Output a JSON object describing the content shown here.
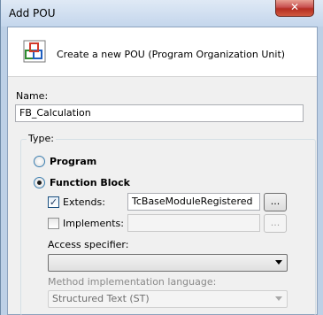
{
  "window": {
    "title": "Add POU",
    "close_glyph": "✕"
  },
  "header": {
    "icon": "pou-icon",
    "text": "Create a new POU (Program Organization Unit)"
  },
  "name_field": {
    "label": "Name:",
    "value": "FB_Calculation"
  },
  "type_group": {
    "legend": "Type:",
    "program_label": "Program",
    "function_block_label": "Function Block",
    "extends": {
      "label": "Extends:",
      "checked": true,
      "value": "TcBaseModuleRegistered",
      "browse_label": "..."
    },
    "implements": {
      "label": "Implements:",
      "checked": false,
      "value": "",
      "browse_label": "..."
    },
    "access_specifier": {
      "label": "Access specifier:",
      "value": ""
    },
    "impl_language": {
      "label": "Method implementation language:",
      "value": "Structured Text (ST)"
    }
  },
  "colors": {
    "accent": "#3c7fb1",
    "titlebar": "#c4d6ec",
    "close": "#c75050"
  }
}
